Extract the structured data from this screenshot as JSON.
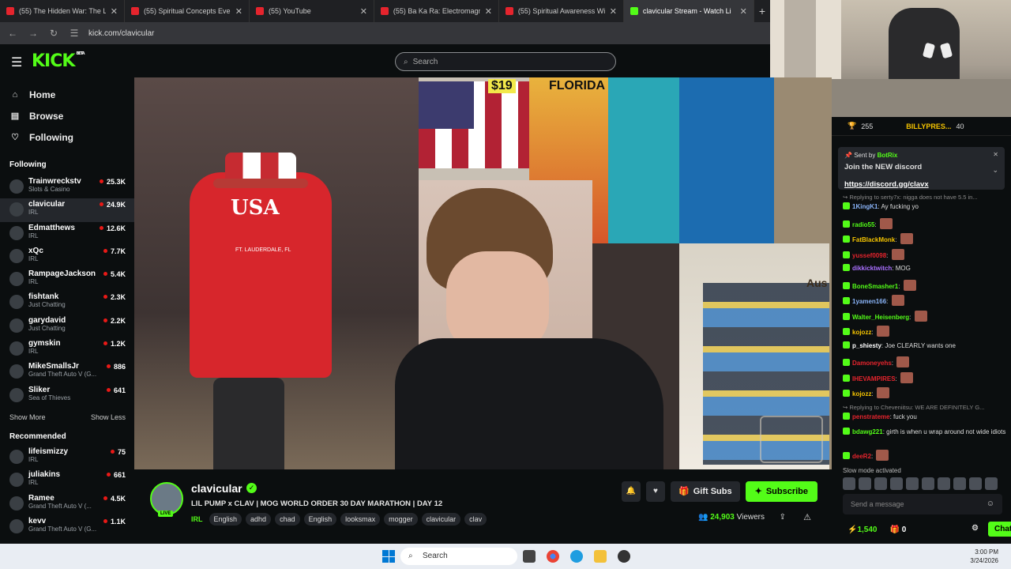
{
  "browser": {
    "tabs": [
      {
        "title": "(55) The Hidden War: The Loosh",
        "active": false
      },
      {
        "title": "(55) Spiritual Concepts Everyone",
        "active": false
      },
      {
        "title": "(55) YouTube",
        "active": false
      },
      {
        "title": "(55) Ba Ka Ra: Electromagnetic",
        "active": false
      },
      {
        "title": "(55) Spiritual Awareness Will Re",
        "active": false
      },
      {
        "title": "clavicular Stream - Watch Li",
        "active": true
      }
    ],
    "new_tab": "+",
    "url": "kick.com/clavicular"
  },
  "header": {
    "logo": "KICK",
    "logo_beta": "BETA",
    "search_placeholder": "Search"
  },
  "sidebar": {
    "nav": [
      {
        "label": "Home",
        "icon": "home-icon"
      },
      {
        "label": "Browse",
        "icon": "browse-icon"
      },
      {
        "label": "Following",
        "icon": "heart-icon"
      }
    ],
    "following_title": "Following",
    "following": [
      {
        "name": "Trainwreckstv",
        "category": "Slots & Casino",
        "viewers": "25.3K"
      },
      {
        "name": "clavicular",
        "category": "IRL",
        "viewers": "24.9K",
        "active": true
      },
      {
        "name": "Edmatthews",
        "category": "IRL",
        "viewers": "12.6K"
      },
      {
        "name": "xQc",
        "category": "IRL",
        "viewers": "7.7K"
      },
      {
        "name": "RampageJackson",
        "category": "IRL",
        "viewers": "5.4K"
      },
      {
        "name": "fishtank",
        "category": "Just Chatting",
        "viewers": "2.3K"
      },
      {
        "name": "garydavid",
        "category": "Just Chatting",
        "viewers": "2.2K"
      },
      {
        "name": "gymskin",
        "category": "IRL",
        "viewers": "1.2K"
      },
      {
        "name": "MikeSmallsJr",
        "category": "Grand Theft Auto V (G...",
        "viewers": "886"
      },
      {
        "name": "Sliker",
        "category": "Sea of Thieves",
        "viewers": "641"
      }
    ],
    "show_more": "Show More",
    "show_less": "Show Less",
    "recommended_title": "Recommended",
    "recommended": [
      {
        "name": "lifeismizzy",
        "category": "IRL",
        "viewers": "75"
      },
      {
        "name": "juliakins",
        "category": "IRL",
        "viewers": "661"
      },
      {
        "name": "Ramee",
        "category": "Grand Theft Auto V (...",
        "viewers": "4.5K"
      },
      {
        "name": "kevv",
        "category": "Grand Theft Auto V (G...",
        "viewers": "1.1K"
      }
    ]
  },
  "video": {
    "shirt_text": "USA",
    "shirt_subtext": "FT. LAUDERDALE, FL",
    "sign_text": "$19",
    "sign2_text": "FLORIDA",
    "sign3_text": "Aus"
  },
  "stream": {
    "streamer": "clavicular",
    "live_badge": "LIVE",
    "title": "LIL PUMP x CLAV | MOG WORLD ORDER 30 DAY MARATHON | DAY 12",
    "category": "IRL",
    "tags": [
      "English",
      "adhd",
      "chad",
      "English",
      "looksmax",
      "mogger",
      "clavicular",
      "clav"
    ],
    "gift_subs_label": "Gift Subs",
    "subscribe_label": "Subscribe",
    "viewers": "24,903",
    "viewers_label": "Viewers"
  },
  "chat": {
    "leaderboard": [
      {
        "value": "255"
      },
      {
        "name": "BILLYPRES...",
        "value": "40"
      }
    ],
    "pinned": {
      "sent_by_label": "Sent by",
      "sent_by": "BotRix",
      "message": "Join the NEW discord",
      "link": "https://discord.gg/clavx"
    },
    "messages": [
      {
        "type": "reply",
        "text": "Replying to serty7x: nigga does not have 5.5 in..."
      },
      {
        "user": "1KingK1",
        "color": "#8ab4f8",
        "text": "Ay fucking yo"
      },
      {
        "user": "radio55",
        "color": "#53fc18",
        "text": "",
        "emote": true
      },
      {
        "user": "FatBlackMonk",
        "color": "#f5c400",
        "text": "",
        "emote": true
      },
      {
        "user": "yussef0098",
        "color": "#e5242d",
        "text": "",
        "emote": true
      },
      {
        "user": "dikkicktwitch",
        "color": "#a970ff",
        "text": "MOG"
      },
      {
        "user": "BoneSmasher1",
        "color": "#53fc18",
        "text": "",
        "emote": true
      },
      {
        "user": "1yamen166",
        "color": "#8ab4f8",
        "text": "",
        "emote": true
      },
      {
        "user": "Walter_Heisenberg",
        "color": "#53fc18",
        "text": "",
        "emote": true
      },
      {
        "user": "kojozz",
        "color": "#f5c400",
        "text": "",
        "emote": true
      },
      {
        "user": "p_shiesty",
        "color": "#ffffff",
        "text": "Joe CLEARLY wants one"
      },
      {
        "user": "Damoneyehs",
        "color": "#e5242d",
        "text": "",
        "emote": true
      },
      {
        "user": "IHEVAMPIRES",
        "color": "#e5242d",
        "text": "",
        "emote": true
      },
      {
        "user": "kojozz",
        "color": "#f5c400",
        "text": "",
        "emote": true
      },
      {
        "type": "reply",
        "text": "Replying to Cheveniitsu: WE ARE DEFINITELY G..."
      },
      {
        "user": "penstrateme",
        "color": "#e5242d",
        "text": "fuck you"
      },
      {
        "user": "bdawg221",
        "color": "#53fc18",
        "text": "girth is when u wrap around not wide idiots",
        "wrap": true
      },
      {
        "user": "deeR2",
        "color": "#e5242d",
        "text": "",
        "emote": true
      }
    ],
    "slow_mode": "Slow mode activated",
    "input_placeholder": "Send a message",
    "points": "1,540",
    "gifts": "0",
    "chat_button": "Chat"
  },
  "taskbar": {
    "search_label": "Search",
    "time": "3:00 PM",
    "date": "3/24/2026"
  }
}
